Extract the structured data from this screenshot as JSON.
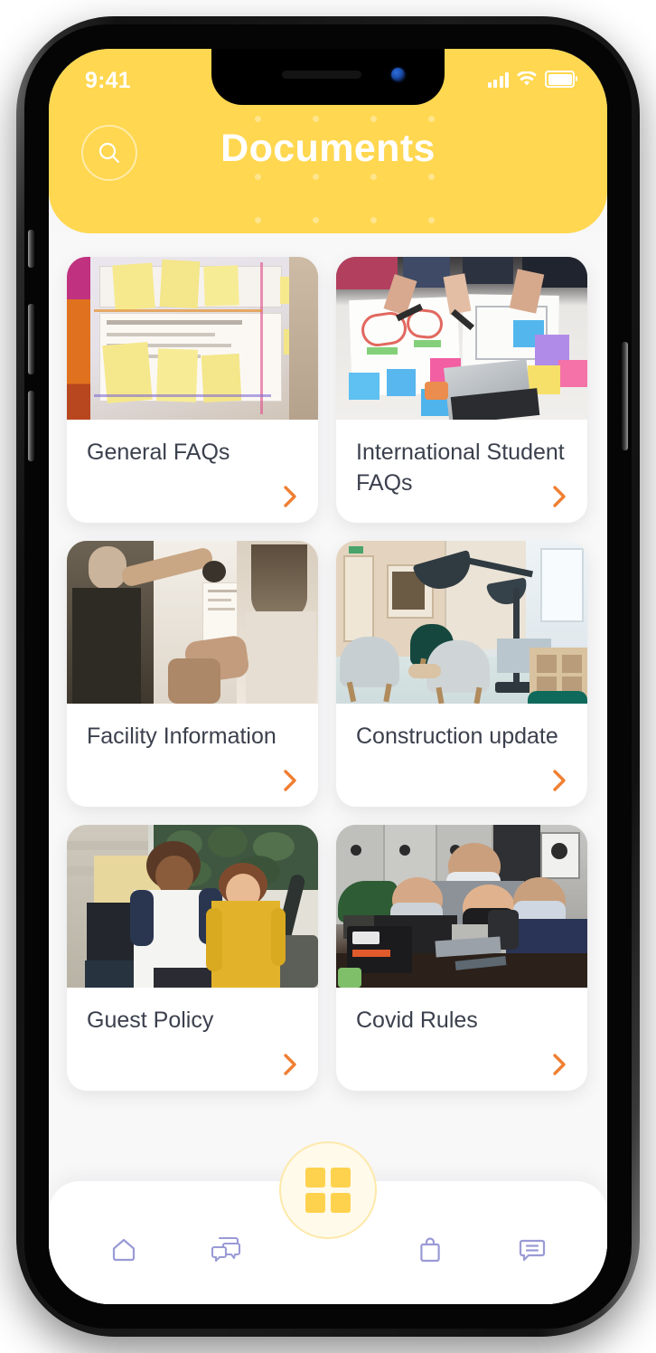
{
  "status_bar": {
    "time": "9:41",
    "signal_icon": "cellular-signal-icon",
    "wifi_icon": "wifi-icon",
    "battery_icon": "battery-full-icon"
  },
  "header": {
    "title": "Documents",
    "background_color": "#FFD750",
    "title_color": "#FFFFFF",
    "search_icon": "search-icon"
  },
  "theme": {
    "accent_yellow": "#FFD750",
    "arrow_orange": "#F07F32",
    "nav_icon_color": "#9a9ad6",
    "card_title_color": "#3B404D",
    "page_background": "#F8F8F8"
  },
  "documents": [
    {
      "title": "General FAQs",
      "image_alt": "Whiteboard covered with yellow sticky notes and printed charts",
      "arrow_icon": "chevron-right-icon"
    },
    {
      "title": "International Student FAQs",
      "image_alt": "Overhead view of people sketching on paper with colourful sticky notes and a laptop",
      "arrow_icon": "chevron-right-icon"
    },
    {
      "title": "Facility Information",
      "image_alt": "Two people pinning documents on a white wall",
      "arrow_icon": "chevron-right-icon"
    },
    {
      "title": "Construction update",
      "image_alt": "Modern lounge interior with armchairs and a large arc lamp",
      "arrow_icon": "chevron-right-icon"
    },
    {
      "title": "Guest Policy",
      "image_alt": "Three students talking outdoors near green plants",
      "arrow_icon": "chevron-right-icon"
    },
    {
      "title": "Covid Rules",
      "image_alt": "Group of people wearing face masks gathered around a table with a laptop",
      "arrow_icon": "chevron-right-icon"
    }
  ],
  "bottom_nav": {
    "items": [
      {
        "name": "home",
        "icon": "home-icon"
      },
      {
        "name": "chats",
        "icon": "chat-bubbles-icon"
      },
      {
        "name": "apps",
        "icon": "grid-apps-icon"
      },
      {
        "name": "shop",
        "icon": "shopping-bag-icon"
      },
      {
        "name": "messages",
        "icon": "message-icon"
      }
    ],
    "active_item": "apps"
  }
}
